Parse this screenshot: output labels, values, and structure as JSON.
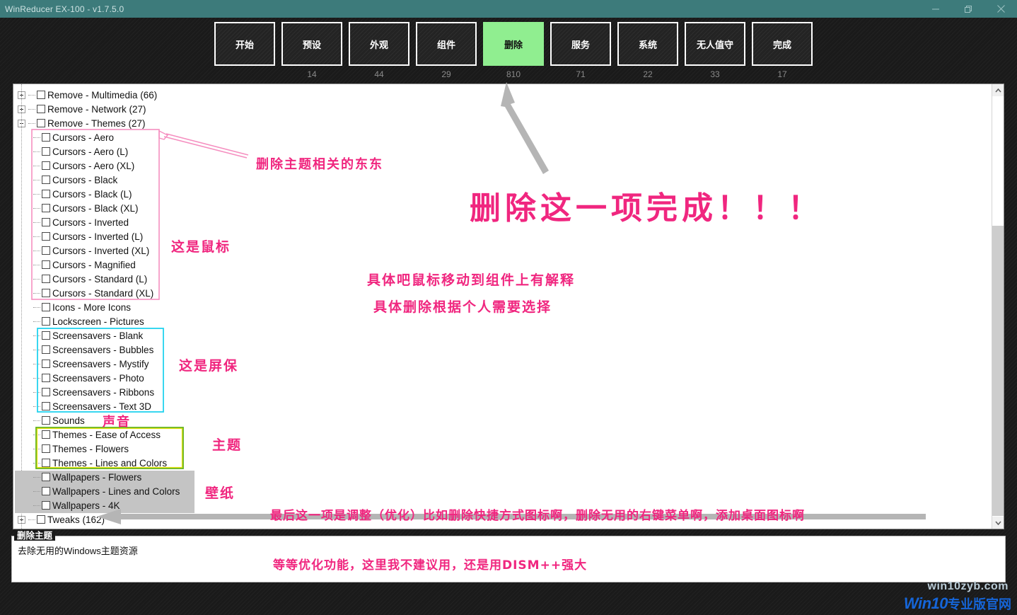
{
  "window": {
    "title": "WinReducer EX-100 - v1.7.5.0",
    "controls": [
      {
        "name": "minimize-button",
        "glyph": "minimize-icon"
      },
      {
        "name": "restore-button",
        "glyph": "restore-icon"
      },
      {
        "name": "close-button",
        "glyph": "close-icon"
      }
    ],
    "titlebar_color": "#3d7b7b"
  },
  "tabs": {
    "active": "删除",
    "active_color": "#90ee90",
    "items": [
      {
        "label": "开始",
        "count": ""
      },
      {
        "label": "预设",
        "count": "14"
      },
      {
        "label": "外观",
        "count": "44"
      },
      {
        "label": "组件",
        "count": "29"
      },
      {
        "label": "删除",
        "count": "810"
      },
      {
        "label": "服务",
        "count": "71"
      },
      {
        "label": "系统",
        "count": "22"
      },
      {
        "label": "无人值守",
        "count": "33"
      },
      {
        "label": "完成",
        "count": "17"
      }
    ]
  },
  "tree": {
    "rows": [
      {
        "label": "Remove - Multimedia (66)",
        "level": 0,
        "expander": "plus"
      },
      {
        "label": "Remove - Network (27)",
        "level": 0,
        "expander": "plus"
      },
      {
        "label": "Remove - Themes (27)",
        "level": 0,
        "expander": "minus"
      },
      {
        "label": "Cursors - Aero",
        "level": 1
      },
      {
        "label": "Cursors - Aero (L)",
        "level": 1
      },
      {
        "label": "Cursors - Aero (XL)",
        "level": 1
      },
      {
        "label": "Cursors - Black",
        "level": 1
      },
      {
        "label": "Cursors - Black (L)",
        "level": 1
      },
      {
        "label": "Cursors - Black (XL)",
        "level": 1
      },
      {
        "label": "Cursors - Inverted",
        "level": 1
      },
      {
        "label": "Cursors - Inverted (L)",
        "level": 1
      },
      {
        "label": "Cursors - Inverted (XL)",
        "level": 1
      },
      {
        "label": "Cursors - Magnified",
        "level": 1
      },
      {
        "label": "Cursors - Standard (L)",
        "level": 1
      },
      {
        "label": "Cursors - Standard (XL)",
        "level": 1
      },
      {
        "label": "Icons - More Icons",
        "level": 1
      },
      {
        "label": "Lockscreen - Pictures",
        "level": 1
      },
      {
        "label": "Screensavers - Blank",
        "level": 1
      },
      {
        "label": "Screensavers - Bubbles",
        "level": 1
      },
      {
        "label": "Screensavers - Mystify",
        "level": 1
      },
      {
        "label": "Screensavers - Photo",
        "level": 1
      },
      {
        "label": "Screensavers - Ribbons",
        "level": 1
      },
      {
        "label": "Screensavers - Text 3D",
        "level": 1
      },
      {
        "label": "Sounds",
        "level": 1
      },
      {
        "label": "Themes - Ease of Access",
        "level": 1
      },
      {
        "label": "Themes - Flowers",
        "level": 1
      },
      {
        "label": "Themes - Lines and Colors",
        "level": 1
      },
      {
        "label": "Wallpapers - Flowers",
        "level": 1,
        "selected": true
      },
      {
        "label": "Wallpapers - Lines and Colors",
        "level": 1,
        "selected": true
      },
      {
        "label": "Wallpapers - 4K",
        "level": 1,
        "selected": true
      },
      {
        "label": "Tweaks (162)",
        "level": 0,
        "expander": "plus"
      }
    ]
  },
  "info": {
    "legend": "删除主题",
    "text": "去除无用的Windows主题资源"
  },
  "annotations": {
    "themes_note": "删除主题相关的东东",
    "headline": "删除这一项完成！！！",
    "cursors_label": "这是鼠标",
    "screensavers_label": "这是屏保",
    "sounds_label": "声音",
    "themes_label": "主题",
    "wallpapers_label": "壁纸",
    "hint_line1": "具体吧鼠标移动到组件上有解释",
    "hint_line2": "具体删除根据个人需要选择",
    "tweaks_note": "最后这一项是调整（优化）比如删除快捷方式图标啊，删除无用的右键菜单啊，添加桌面图标啊",
    "footer_note": "等等优化功能，这里我不建议用，还是用DISM++强大",
    "ink_color": "#f0267f"
  },
  "watermark": {
    "line1": "win10zyb.com",
    "line2_main": "Win10",
    "line2_sub": "专业版官网"
  }
}
